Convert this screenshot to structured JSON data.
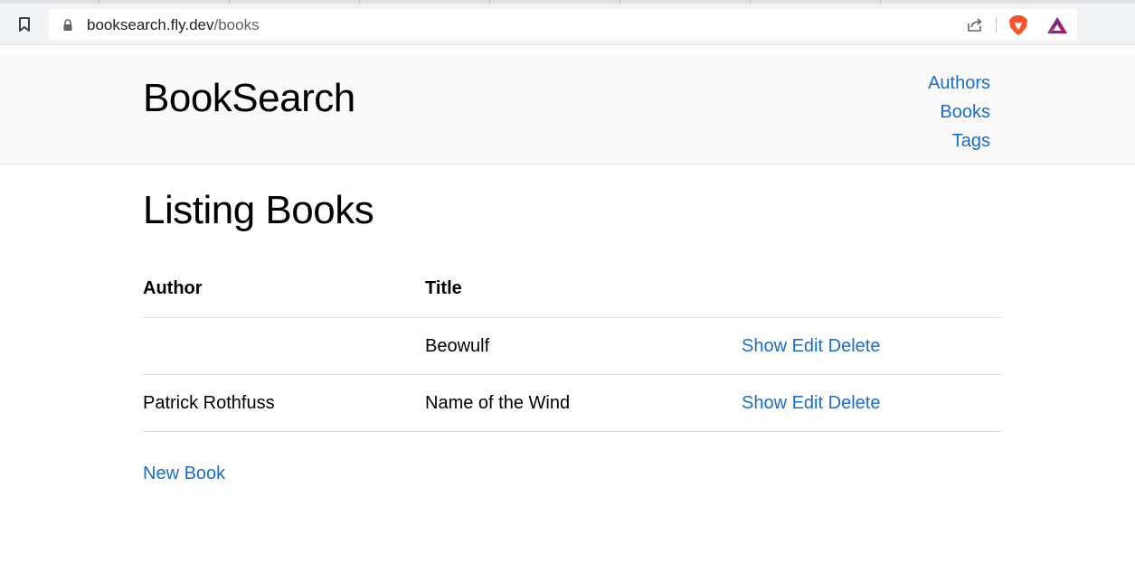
{
  "browser": {
    "url_host": "booksearch.fly.dev",
    "url_path": "/books",
    "icons": [
      "bookmark-icon",
      "lock-icon",
      "share-icon",
      "brave-shields-icon",
      "brave-rewards-icon"
    ]
  },
  "header": {
    "site_title": "BookSearch",
    "nav": [
      {
        "label": "Authors"
      },
      {
        "label": "Books"
      },
      {
        "label": "Tags"
      }
    ]
  },
  "main": {
    "title": "Listing Books",
    "table": {
      "columns": [
        "Author",
        "Title",
        ""
      ],
      "rows": [
        {
          "author": "",
          "title": "Beowulf",
          "actions": {
            "show": "Show",
            "edit": "Edit",
            "delete": "Delete"
          }
        },
        {
          "author": "Patrick Rothfuss",
          "title": "Name of the Wind",
          "actions": {
            "show": "Show",
            "edit": "Edit",
            "delete": "Delete"
          }
        }
      ]
    },
    "new_book_label": "New Book"
  },
  "colors": {
    "link": "#1a6ccd",
    "header_bg": "#fafafa"
  }
}
